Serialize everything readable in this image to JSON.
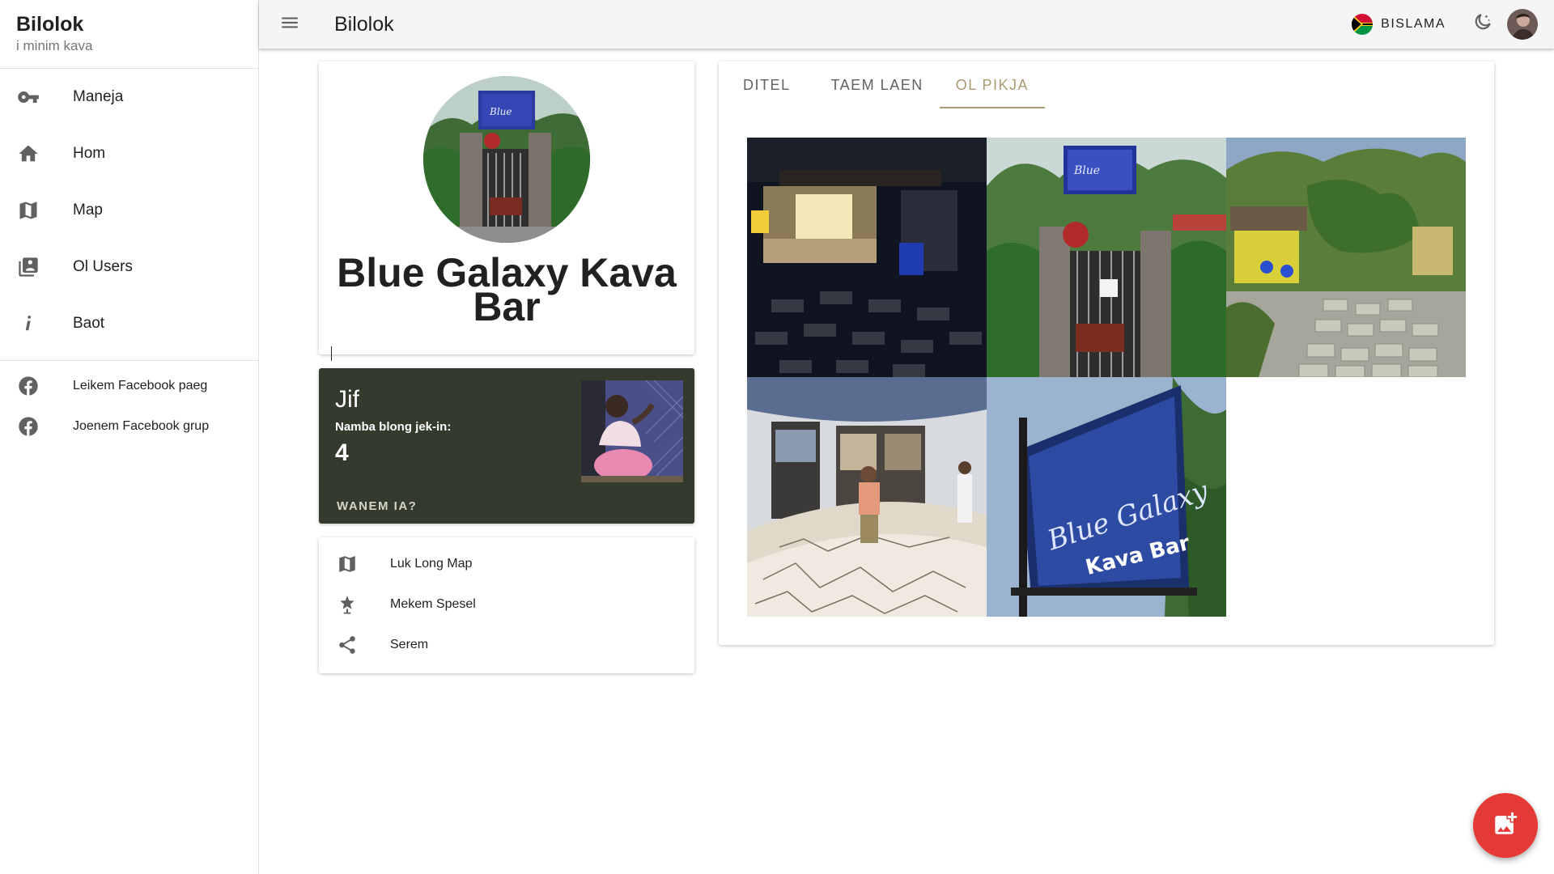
{
  "sidebar": {
    "title": "Bilolok",
    "subtitle": "i minim kava",
    "items": [
      {
        "label": "Maneja",
        "icon": "key-icon"
      },
      {
        "label": "Hom",
        "icon": "home-icon"
      },
      {
        "label": "Map",
        "icon": "map-icon"
      },
      {
        "label": "Ol Users",
        "icon": "users-icon"
      },
      {
        "label": "Baot",
        "icon": "info-icon"
      }
    ],
    "links": [
      {
        "label": "Leikem Facebook paeg",
        "icon": "facebook-icon"
      },
      {
        "label": "Joenem Facebook grup",
        "icon": "facebook-icon"
      }
    ]
  },
  "topbar": {
    "title": "Bilolok",
    "language": "BISLAMA",
    "menu_icon": "menu-icon",
    "theme_icon": "moon-icon"
  },
  "profile": {
    "name": "Blue Galaxy Kava Bar"
  },
  "chief": {
    "title": "Jif",
    "label": "Namba blong jek-in:",
    "count": "4",
    "link": "WANEM IA?"
  },
  "actions": [
    {
      "label": "Luk Long Map",
      "icon": "map-icon"
    },
    {
      "label": "Mekem Spesel",
      "icon": "star-icon"
    },
    {
      "label": "Serem",
      "icon": "share-icon"
    }
  ],
  "tabs": [
    {
      "label": "DITEL",
      "active": false
    },
    {
      "label": "TAEM LAEN",
      "active": false
    },
    {
      "label": "OL PIKJA",
      "active": true
    }
  ],
  "colors": {
    "accent": "#a99a72",
    "chief_bg": "#343a2c",
    "fab": "#e53935"
  },
  "fab_icon": "add-photo-icon"
}
